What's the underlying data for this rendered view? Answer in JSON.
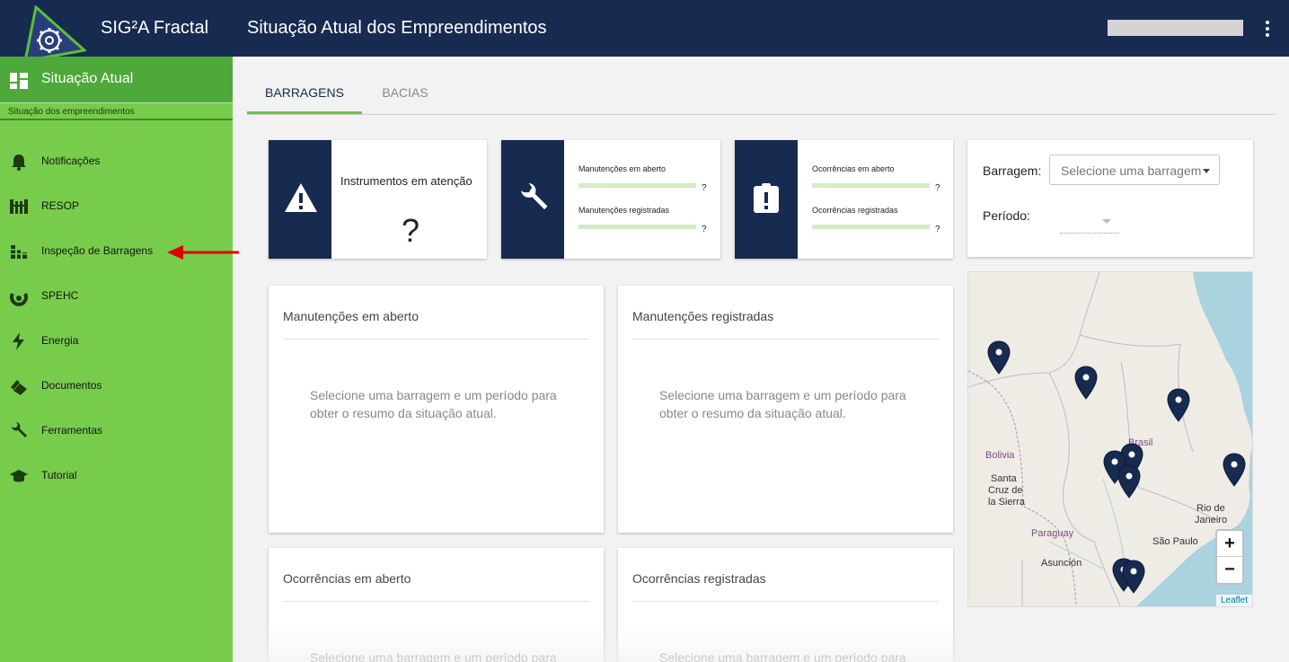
{
  "header": {
    "app_name": "SIG²A Fractal",
    "page_title": "Situação Atual dos Empreendimentos",
    "menu_icon": "more-vertical-icon",
    "logo_icon": "gear-triangle-logo"
  },
  "sidebar": {
    "title": "Situação Atual",
    "subtitle": "Situação dos empreendimentos",
    "items": [
      {
        "label": "Notificações",
        "icon": "bell-icon"
      },
      {
        "label": "RESOP",
        "icon": "dam-grid-icon"
      },
      {
        "label": "Inspeção de Barragens",
        "icon": "dam-inspection-icon"
      },
      {
        "label": "SPEHC",
        "icon": "hydro-icon"
      },
      {
        "label": "Energia",
        "icon": "lightning-icon"
      },
      {
        "label": "Documentos",
        "icon": "documents-icon"
      },
      {
        "label": "Ferramentas",
        "icon": "wrench-icon"
      },
      {
        "label": "Tutorial",
        "icon": "graduation-cap-icon"
      }
    ],
    "highlight_color": "#e00000"
  },
  "tabs": [
    {
      "label": "BARRAGENS",
      "active": true
    },
    {
      "label": "BACIAS",
      "active": false
    }
  ],
  "stats": {
    "instrumentos": {
      "title": "Instrumentos em atenção",
      "value": "?"
    },
    "manutencoes": {
      "rows": [
        {
          "label": "Manutenções em aberto",
          "value": "?"
        },
        {
          "label": "Manutenções registradas",
          "value": "?"
        }
      ]
    },
    "ocorrencias": {
      "rows": [
        {
          "label": "Ocorrências em aberto",
          "value": "?"
        },
        {
          "label": "Ocorrências registradas",
          "value": "?"
        }
      ]
    }
  },
  "filters": {
    "barragem_label": "Barragem:",
    "barragem_value": "Selecione uma barragem",
    "periodo_label": "Período:",
    "periodo_value": ""
  },
  "map": {
    "labels": {
      "bolivia": "Bolivia",
      "santa_cruz_1": "Santa",
      "santa_cruz_2": "Cruz de",
      "santa_cruz_3": "la Sierra",
      "brasil": "Brasil",
      "paraguay": "Paraguay",
      "asuncion": "Asunción",
      "rio_1": "Rio de",
      "rio_2": "Janeiro",
      "sao_paulo": "São Paulo"
    },
    "zoom_in": "+",
    "zoom_out": "−",
    "attribution": "Leaflet"
  },
  "summaries": [
    {
      "title": "Manutenções em aberto",
      "message": "Selecione uma barragem e um período para obter o resumo da situação atual."
    },
    {
      "title": "Manutenções registradas",
      "message": "Selecione uma barragem e um período para obter o resumo da situação atual."
    },
    {
      "title": "Ocorrências em aberto",
      "message": "Selecione uma barragem e um período para obter o resumo da situação atual."
    },
    {
      "title": "Ocorrências registradas",
      "message": "Selecione uma barragem e um período para obter o resumo da situação atual."
    }
  ],
  "colors": {
    "navy": "#172a4f",
    "sidebar_green": "#77cc4c",
    "sidebar_header_green": "#4ea83a",
    "bar_green": "#d3ecc4",
    "tab_accent": "#6cc341"
  }
}
